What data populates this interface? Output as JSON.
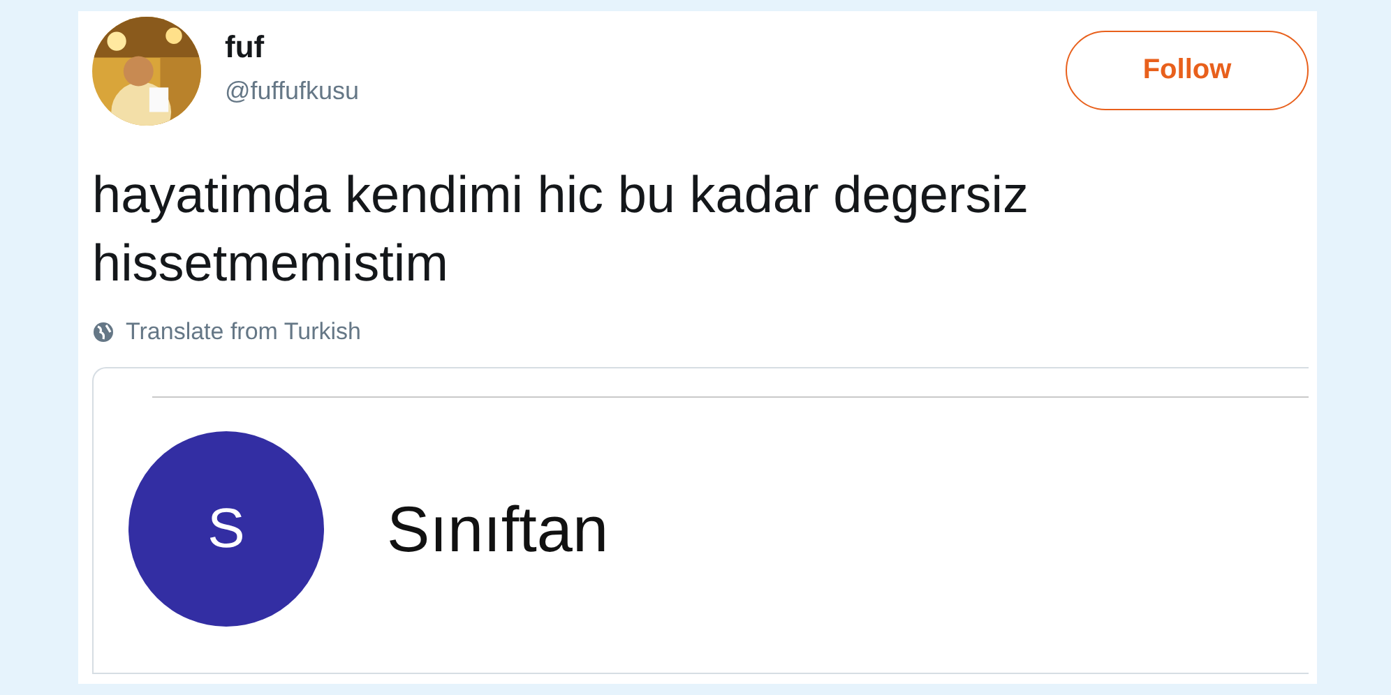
{
  "author": {
    "name": "fuf",
    "handle": "@fuffufkusu"
  },
  "follow_button": {
    "label": "Follow"
  },
  "tweet": {
    "text": "hayatimda kendimi hic bu kadar degersiz hissetmemistim",
    "translate_link": "Translate from Turkish"
  },
  "embedded_screenshot": {
    "avatar_letter": "S",
    "sender": "Sınıftan"
  }
}
